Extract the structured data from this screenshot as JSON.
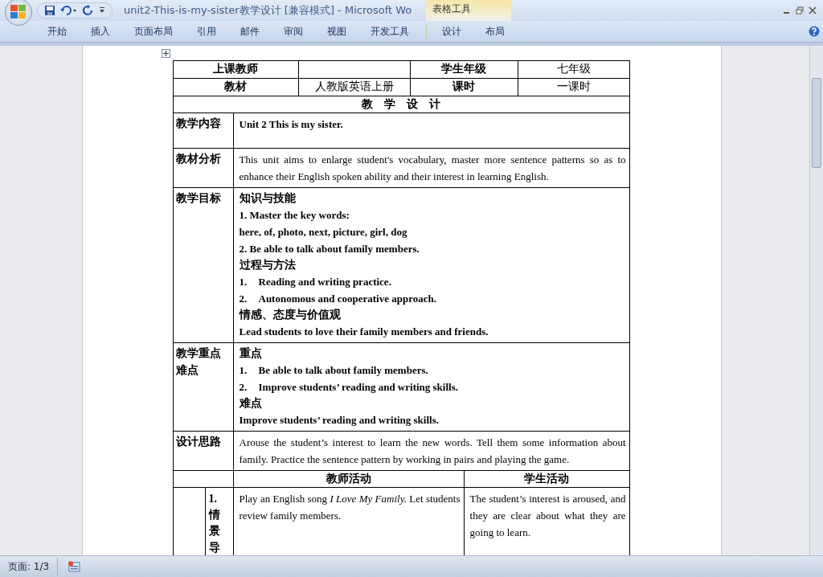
{
  "window": {
    "title": "unit2-This-is-my-sister教学设计 [兼容模式] - Microsoft Wo",
    "context_group": "表格工具"
  },
  "ribbon_tabs": [
    {
      "label": "开始"
    },
    {
      "label": "插入"
    },
    {
      "label": "页面布局"
    },
    {
      "label": "引用"
    },
    {
      "label": "邮件"
    },
    {
      "label": "审阅"
    },
    {
      "label": "视图"
    },
    {
      "label": "开发工具"
    }
  ],
  "context_tabs": [
    {
      "label": "设计"
    },
    {
      "label": "布局"
    }
  ],
  "table": {
    "info_rows": [
      [
        "上课教师",
        "",
        "学生年级",
        "七年级"
      ],
      [
        "教材",
        "人教版英语上册",
        "课时",
        "一课时"
      ]
    ],
    "design_title": "教　学　设　计",
    "sections": [
      {
        "label": [
          "教学内容"
        ],
        "lines": [
          {
            "kind": "bold",
            "text": "Unit 2 This is my sister."
          }
        ]
      },
      {
        "label": [
          "教材分析"
        ],
        "lines": [
          {
            "kind": "plain",
            "text": "This unit aims to enlarge student's vocabulary, master more sentence patterns so as to enhance their English spoken ability and their interest in learning English."
          }
        ]
      },
      {
        "label": [
          "教学目标"
        ],
        "lines": [
          {
            "kind": "heading",
            "text": "知识与技能"
          },
          {
            "kind": "bold",
            "text": "1. Master the key words:"
          },
          {
            "kind": "bold",
            "text": "here, of, photo, next, picture, girl, dog"
          },
          {
            "kind": "bold",
            "text": "2. Be able to talk about family members."
          },
          {
            "kind": "heading",
            "text": "过程与方法"
          },
          {
            "kind": "numbered",
            "number": "1.",
            "text": "Reading and writing practice."
          },
          {
            "kind": "numbered",
            "number": "2.",
            "text": "Autonomous and cooperative approach."
          },
          {
            "kind": "heading",
            "text": "情感、态度与价值观"
          },
          {
            "kind": "bold",
            "text": "Lead students to love their family members and friends."
          }
        ]
      },
      {
        "label": [
          "教学重点",
          "难点"
        ],
        "lines": [
          {
            "kind": "heading",
            "text": "重点"
          },
          {
            "kind": "numbered",
            "number": "1.",
            "text": "Be able to talk about family members."
          },
          {
            "kind": "numbered",
            "number": "2.",
            "text": "Improve students’ reading and writing skills."
          },
          {
            "kind": "heading",
            "text": "难点"
          },
          {
            "kind": "bold",
            "text": "Improve students’ reading and writing skills."
          }
        ]
      },
      {
        "label": [
          "设计思路"
        ],
        "lines": [
          {
            "kind": "plain",
            "text": "Arouse the student’s interest to learn the new words. Tell them some information about family. Practice the sentence pattern by working in pairs and playing the game."
          }
        ]
      }
    ],
    "activity_headers": [
      "教师活动",
      "学生活动"
    ],
    "activities": [
      {
        "number": "1.",
        "title": "情景导",
        "teacher": "Play an English song *I Love My Family.* Let students review family members.",
        "student": "The student’s interest is aroused, and they are clear about what they are going to learn."
      }
    ]
  },
  "status_bar": {
    "page": "页面: 1/3"
  }
}
